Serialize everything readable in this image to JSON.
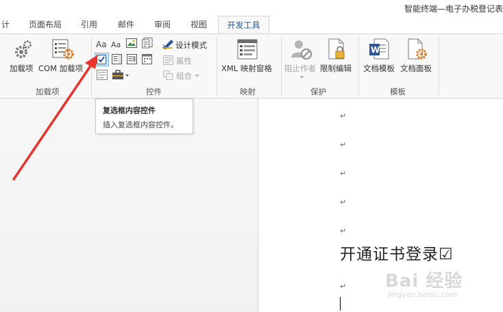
{
  "title_bar": {
    "title": "智能终端—电子办税登记表"
  },
  "tabs": [
    {
      "label": "计"
    },
    {
      "label": "页面布局"
    },
    {
      "label": "引用"
    },
    {
      "label": "邮件"
    },
    {
      "label": "审阅"
    },
    {
      "label": "视图"
    },
    {
      "label": "开发工具",
      "active": true
    }
  ],
  "ribbon": {
    "addins": {
      "group_label": "加载项",
      "addins_label": "加载项",
      "com_addins_label": "COM 加载项"
    },
    "controls": {
      "group_label": "控件",
      "design_mode_label": "设计模式",
      "properties_label": "属性",
      "group_button_label": "组合"
    },
    "mapping": {
      "group_label": "映射",
      "xml_pane_label": "XML 映射窗格"
    },
    "protect": {
      "group_label": "保护",
      "block_authors_label": "阻止作者",
      "restrict_editing_label": "限制编辑"
    },
    "templates": {
      "group_label": "模板",
      "document_template_label": "文档模板",
      "document_panel_label": "文档面板"
    }
  },
  "tooltip": {
    "title": "复选框内容控件",
    "description": "插入复选框内容控件。"
  },
  "document": {
    "paragraph_mark": "↵",
    "text_line": "开通证书登录☑"
  },
  "watermark": {
    "main": "Bai 经验",
    "sub": "jingyan.baidu.com"
  },
  "colors": {
    "accent": "#2b579a",
    "arrow": "#e8322b",
    "ribbon_bg": "#f8f8f8"
  }
}
